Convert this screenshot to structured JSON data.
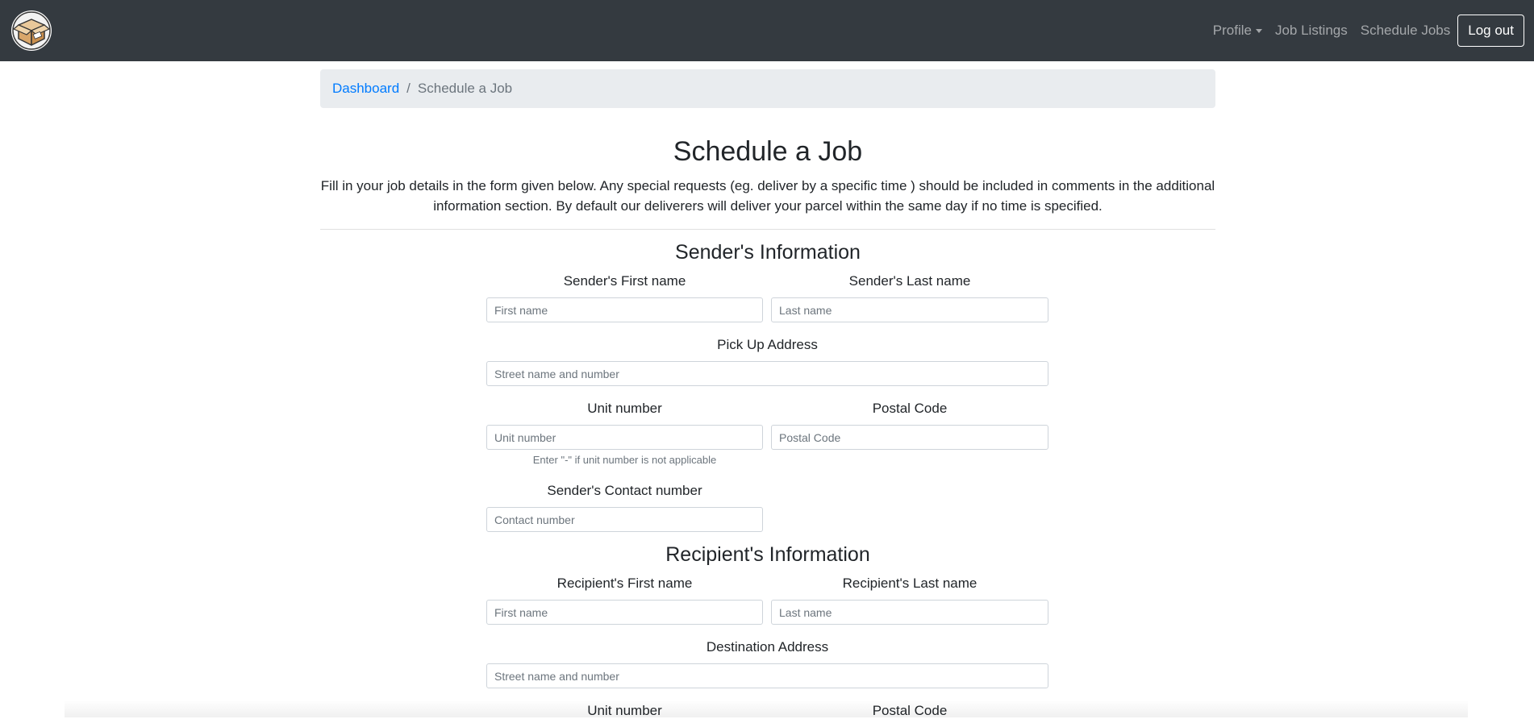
{
  "navbar": {
    "logo_icon": "package-box-logo",
    "profile_label": "Profile",
    "job_listings_label": "Job Listings",
    "schedule_jobs_label": "Schedule Jobs",
    "logout_label": "Log out"
  },
  "breadcrumb": {
    "home": "Dashboard",
    "separator": "/",
    "current": "Schedule a Job"
  },
  "header": {
    "title": "Schedule a Job",
    "description": "Fill in your job details in the form given below. Any special requests (eg. deliver by a specific time ) should be included in comments in the additional information section. By default our deliverers will deliver your parcel within the same day if no time is specified."
  },
  "sender": {
    "section_title": "Sender's Information",
    "first_name_label": "Sender's First name",
    "first_name_placeholder": "First name",
    "last_name_label": "Sender's Last name",
    "last_name_placeholder": "Last name",
    "address_label": "Pick Up Address",
    "address_placeholder": "Street name and number",
    "unit_label": "Unit number",
    "unit_placeholder": "Unit number",
    "unit_help": "Enter \"-\" if unit number is not applicable",
    "postal_label": "Postal Code",
    "postal_placeholder": "Postal Code",
    "contact_label": "Sender's Contact number",
    "contact_placeholder": "Contact number"
  },
  "recipient": {
    "section_title": "Recipient's Information",
    "first_name_label": "Recipient's First name",
    "first_name_placeholder": "First name",
    "last_name_label": "Recipient's Last name",
    "last_name_placeholder": "Last name",
    "address_label": "Destination Address",
    "address_placeholder": "Street name and number",
    "unit_label": "Unit number",
    "postal_label": "Postal Code"
  },
  "colors": {
    "navbar_bg": "#343a40",
    "link": "#007bff",
    "breadcrumb_bg": "#e9ecef"
  }
}
